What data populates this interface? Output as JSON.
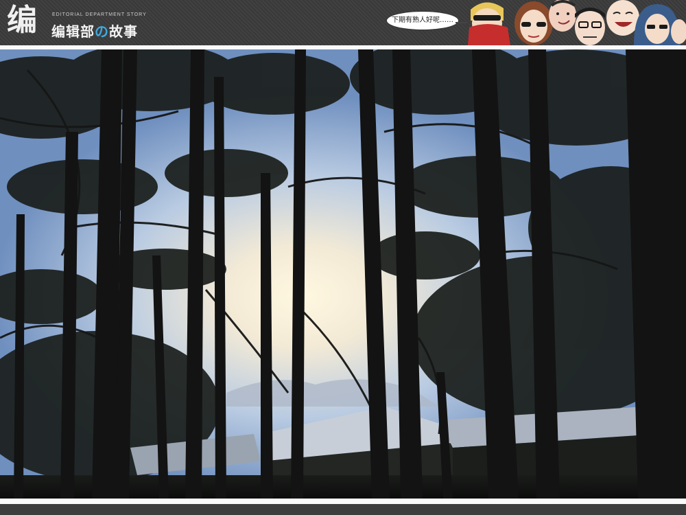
{
  "header": {
    "logo_glyph": "编",
    "logo_subtitle": "EDITORIAL DEPARTMENT STORY",
    "logo_title_part1": "编辑部",
    "logo_title_accent": "の",
    "logo_title_part2": "故事",
    "speech_bubble": "下期有熟人好呢……",
    "character_icons": [
      "scarf-masked-character-icon",
      "sunglasses-woman-character-icon",
      "smirking-man-character-icon",
      "glasses-man-character-icon",
      "bald-laughing-character-icon",
      "hooded-woman-character-icon"
    ]
  },
  "photo": {
    "subject": "pine-forest-silhouette-sunset",
    "colors": {
      "sky": "#c9d8ea",
      "sun": "#fff6d8",
      "trunks": "#141414",
      "roof": "#c8cfd8"
    }
  }
}
